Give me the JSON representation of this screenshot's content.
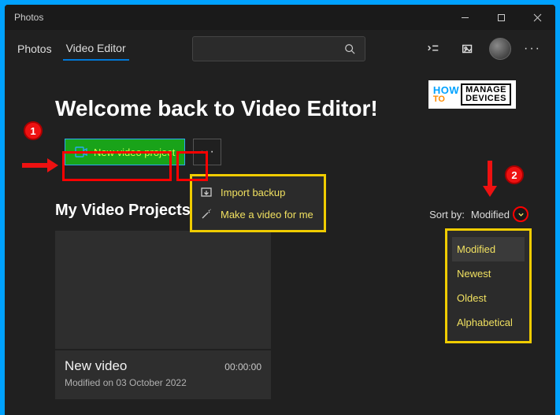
{
  "titlebar": {
    "app_name": "Photos"
  },
  "tabs": {
    "photos": "Photos",
    "video_editor": "Video Editor"
  },
  "search": {
    "placeholder": ""
  },
  "heading": "Welcome back to Video Editor!",
  "actions": {
    "new_project": "New video project",
    "more_menu": [
      {
        "icon": "import-icon",
        "label": "Import backup"
      },
      {
        "icon": "magic-icon",
        "label": "Make a video for me"
      }
    ]
  },
  "projects_heading": "My Video Projects",
  "sort": {
    "label": "Sort by:",
    "current": "Modified",
    "options": [
      "Modified",
      "Newest",
      "Oldest",
      "Alphabetical"
    ]
  },
  "projects": [
    {
      "title": "New video",
      "duration": "00:00:00",
      "subtitle": "Modified on 03 October 2022"
    }
  ],
  "annotations": {
    "step1": "1",
    "step2": "2"
  },
  "watermark": {
    "how": "HOW",
    "to": "TO",
    "manage": "MANAGE",
    "devices": "DEVICES"
  }
}
